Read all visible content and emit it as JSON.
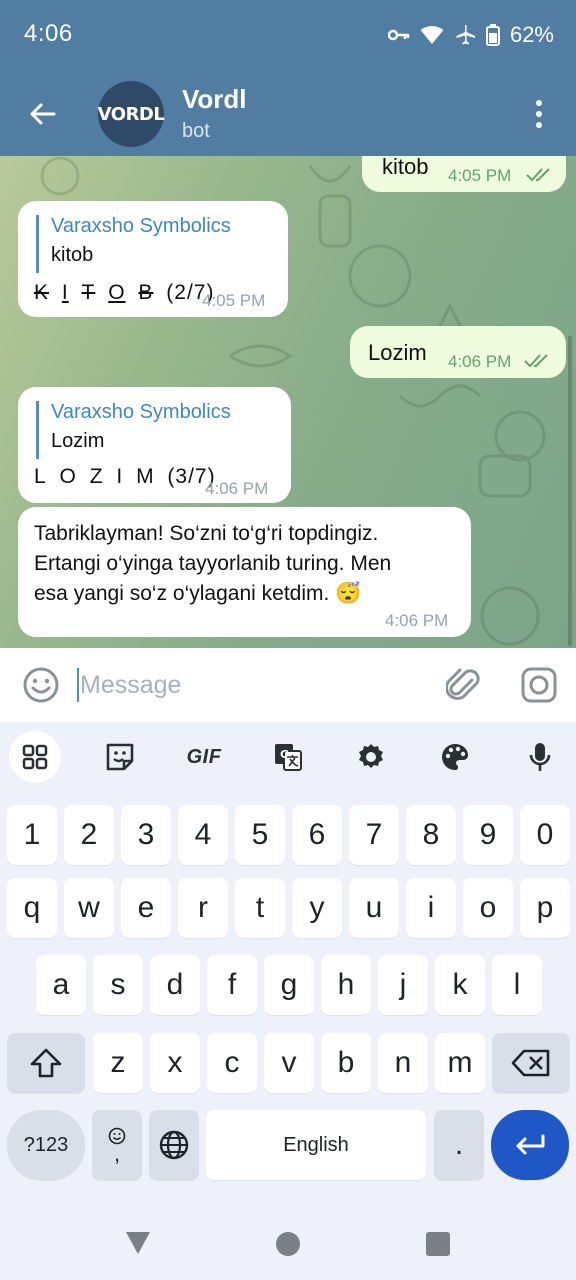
{
  "status_bar": {
    "time": "4:06",
    "battery": "62%"
  },
  "header": {
    "title": "Vordl",
    "subtitle": "bot",
    "avatar_text": "VORDL"
  },
  "messages": [
    {
      "id": "m1",
      "type": "outgoing",
      "text": "kitob",
      "time": "4:05 PM",
      "read": true
    },
    {
      "id": "m2",
      "type": "incoming",
      "reply_name": "Varaxsho Symbolics",
      "reply_text": "kitob",
      "letters": [
        "K",
        "I",
        "T",
        "O",
        "B"
      ],
      "progress": "(2/7)",
      "time": "4:05 PM"
    },
    {
      "id": "m3",
      "type": "outgoing",
      "text": "Lozim",
      "time": "4:06 PM",
      "read": true
    },
    {
      "id": "m4",
      "type": "incoming",
      "reply_name": "Varaxsho Symbolics",
      "reply_text": "Lozim",
      "letters": [
        "L",
        "O",
        "Z",
        "I",
        "M"
      ],
      "progress": "(3/7)",
      "time": "4:06 PM"
    },
    {
      "id": "m5",
      "type": "incoming",
      "lines": [
        "Tabriklayman! So‘zni to‘g‘ri topdingiz.",
        "Ertangi o‘yinga tayyorlanib turing. Men",
        "esa yangi so‘z o‘ylagani ketdim. 😴"
      ],
      "time": "4:06 PM"
    }
  ],
  "composer": {
    "placeholder": "Message",
    "value": ""
  },
  "keyboard": {
    "toolbar": [
      "apps-icon",
      "sticker-icon",
      "GIF",
      "translate-icon",
      "settings-icon",
      "palette-icon",
      "mic-icon"
    ],
    "gif_label": "GIF",
    "row_numbers": [
      "1",
      "2",
      "3",
      "4",
      "5",
      "6",
      "7",
      "8",
      "9",
      "0"
    ],
    "row1": [
      "q",
      "w",
      "e",
      "r",
      "t",
      "y",
      "u",
      "i",
      "o",
      "p"
    ],
    "row2": [
      "a",
      "s",
      "d",
      "f",
      "g",
      "h",
      "j",
      "k",
      "l"
    ],
    "row3": [
      "z",
      "x",
      "c",
      "v",
      "b",
      "n",
      "m"
    ],
    "sym_label": "?123",
    "comma_label": ",",
    "space_label": "English",
    "period_label": "."
  },
  "colors": {
    "header": "#527da3",
    "accent": "#4b8fd1",
    "outgoing_bubble": "#effdde",
    "enter_key": "#1f57c6"
  }
}
